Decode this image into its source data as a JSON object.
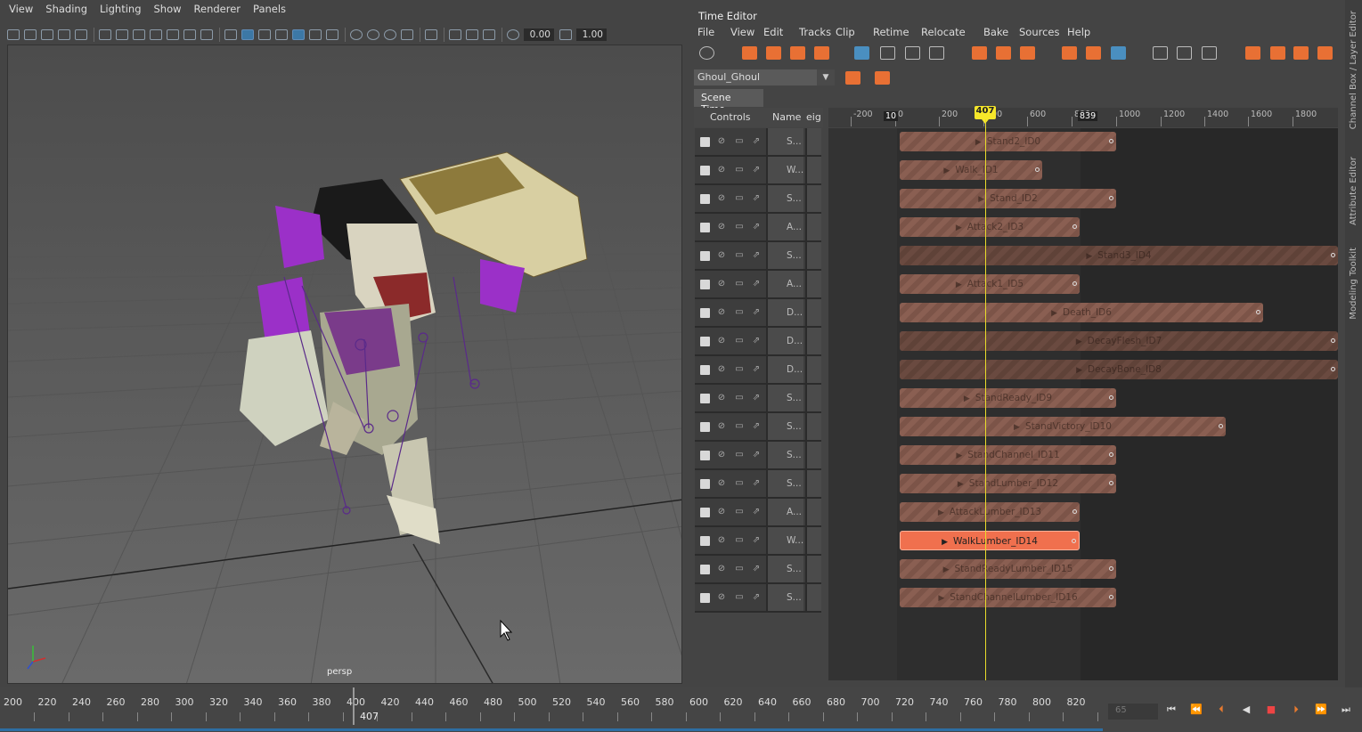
{
  "viewport": {
    "menu": [
      "View",
      "Shading",
      "Lighting",
      "Show",
      "Renderer",
      "Panels"
    ],
    "toolbar": {
      "value1": "0.00",
      "value2": "1.00"
    },
    "camera_label": "persp"
  },
  "time_editor": {
    "title": "Time Editor",
    "menu": [
      "File",
      "View",
      "Edit",
      "Tracks",
      "Clip",
      "Retime",
      "Relocate",
      "Bake",
      "Sources",
      "Help"
    ],
    "composition": "Ghoul_Ghoul",
    "tab": "Scene Time",
    "columns": {
      "controls": "Controls",
      "name": "Name",
      "weight": "eig"
    },
    "ruler_ticks": [
      "-200",
      "0",
      "200",
      "400",
      "600",
      "800",
      "1000",
      "1200",
      "1400",
      "1600",
      "1800"
    ],
    "range_start": "10",
    "range_end": "839",
    "current_frame": "407",
    "tracks": [
      {
        "short": "S...",
        "clip": "Stand2_ID0"
      },
      {
        "short": "W...",
        "clip": "Walk_ID1"
      },
      {
        "short": "S...",
        "clip": "Stand_ID2"
      },
      {
        "short": "A...",
        "clip": "Attack2_ID3"
      },
      {
        "short": "S...",
        "clip": "Stand3_ID4"
      },
      {
        "short": "A...",
        "clip": "Attack1_ID5"
      },
      {
        "short": "D...",
        "clip": "Death_ID6"
      },
      {
        "short": "D...",
        "clip": "DecayFlesh_ID7"
      },
      {
        "short": "D...",
        "clip": "DecayBone_ID8"
      },
      {
        "short": "S...",
        "clip": "StandReady_ID9"
      },
      {
        "short": "S...",
        "clip": "StandVictory_ID10"
      },
      {
        "short": "S...",
        "clip": "StandChannel_ID11"
      },
      {
        "short": "S...",
        "clip": "StandLumber_ID12"
      },
      {
        "short": "A...",
        "clip": "AttackLumber_ID13"
      },
      {
        "short": "W...",
        "clip": "WalkLumber_ID14"
      },
      {
        "short": "S...",
        "clip": "StandReadyLumber_ID15"
      },
      {
        "short": "S...",
        "clip": "StandChannelLumber_ID16"
      }
    ]
  },
  "side_tabs": [
    "Channel Box / Layer Editor",
    "Attribute Editor",
    "Modeling Toolkit"
  ],
  "time_slider": {
    "ticks": [
      "200",
      "220",
      "240",
      "260",
      "280",
      "300",
      "320",
      "340",
      "360",
      "380",
      "400",
      "420",
      "440",
      "460",
      "480",
      "500",
      "520",
      "540",
      "560",
      "580",
      "600",
      "620",
      "640",
      "660",
      "680",
      "700",
      "720",
      "740",
      "760",
      "780",
      "800",
      "820"
    ],
    "current": "407",
    "frame_field": "65"
  },
  "colors": {
    "accent": "#4a8fc0",
    "clip": "#8a5f52",
    "clip_active": "#f0704e",
    "playhead": "#f6e72a"
  }
}
